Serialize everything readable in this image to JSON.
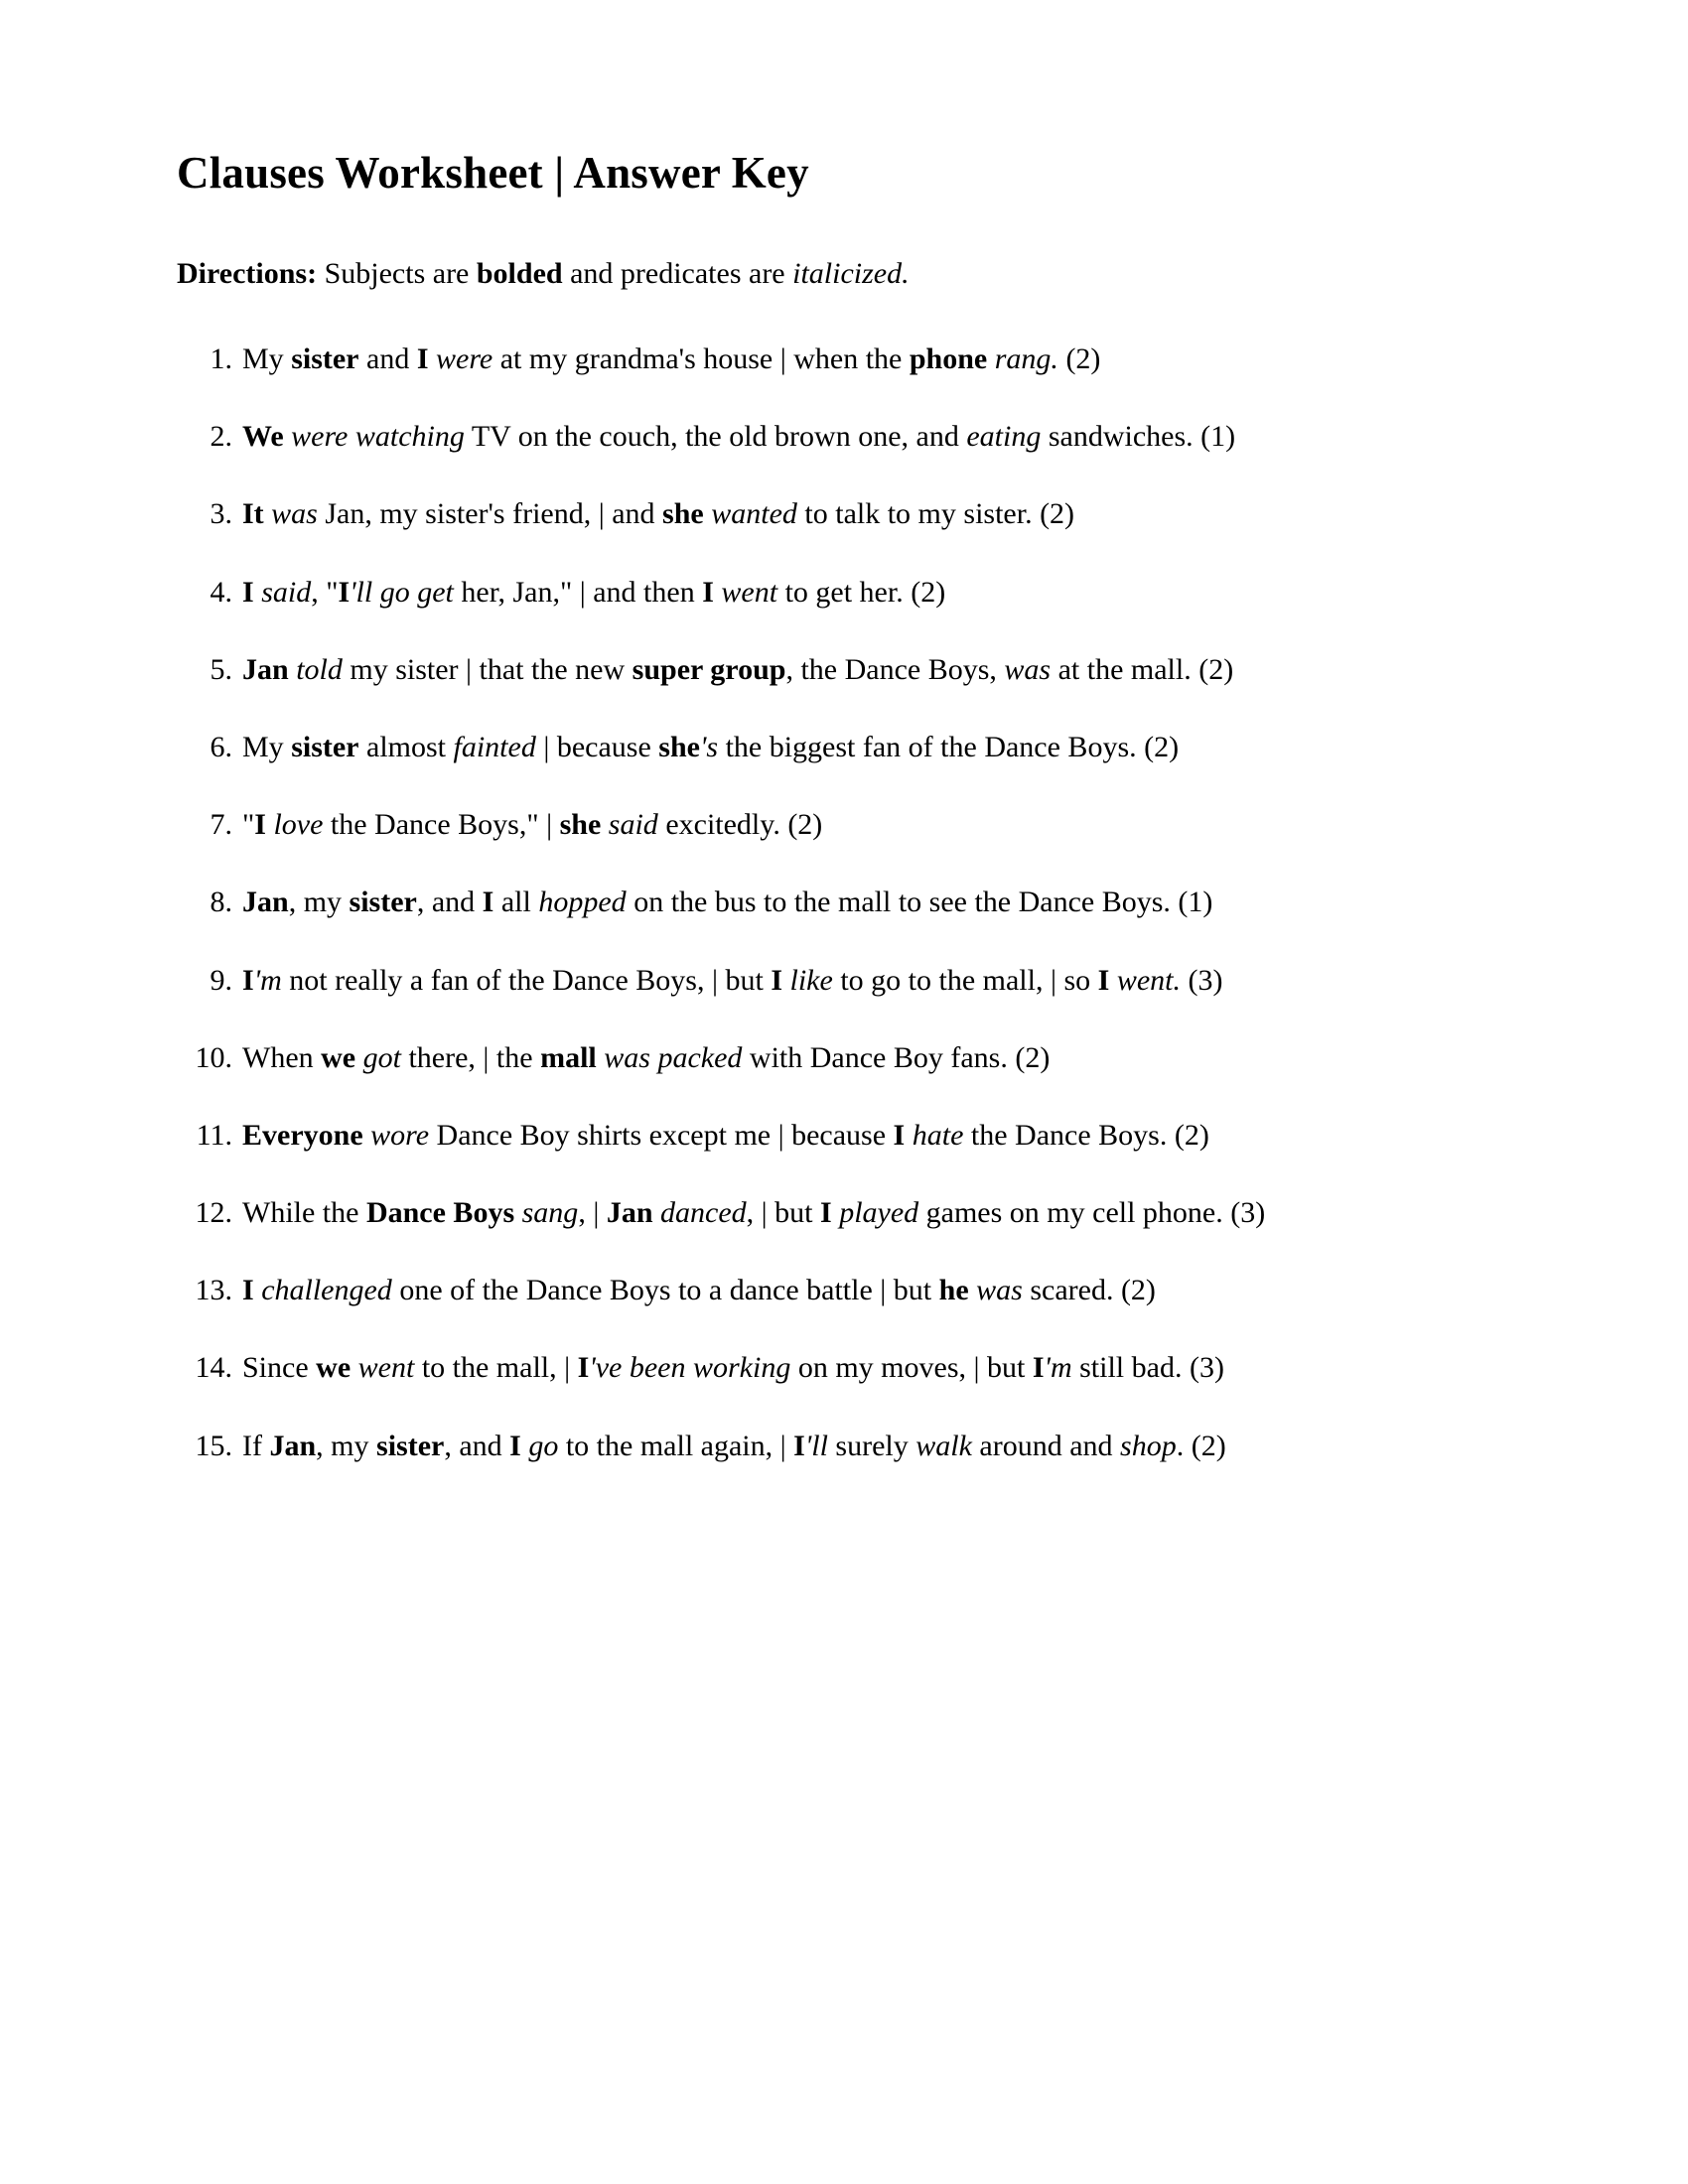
{
  "document": {
    "title": "Clauses Worksheet | Answer Key",
    "directions": [
      {
        "t": "Directions:",
        "f": "b"
      },
      {
        "t": " Subjects are ",
        "f": "n"
      },
      {
        "t": "bolded",
        "f": "b"
      },
      {
        "t": " and predicates are ",
        "f": "n"
      },
      {
        "t": "italicized.",
        "f": "i"
      }
    ],
    "items": [
      {
        "number": "1.",
        "count": "(2)",
        "segments": [
          {
            "t": "My ",
            "f": "n"
          },
          {
            "t": "sister",
            "f": "b"
          },
          {
            "t": " and ",
            "f": "n"
          },
          {
            "t": "I",
            "f": "b"
          },
          {
            "t": " were",
            "f": "i"
          },
          {
            "t": " at my grandma's house | when the ",
            "f": "n"
          },
          {
            "t": "phone",
            "f": "b"
          },
          {
            "t": " rang.",
            "f": "i"
          },
          {
            "t": " (2)",
            "f": "n"
          }
        ]
      },
      {
        "number": "2.",
        "count": "(1)",
        "segments": [
          {
            "t": "We",
            "f": "b"
          },
          {
            "t": " were watching",
            "f": "i"
          },
          {
            "t": " TV on the couch, the old brown one, and ",
            "f": "n"
          },
          {
            "t": "eating",
            "f": "i"
          },
          {
            "t": " sandwiches. (1)",
            "f": "n"
          }
        ]
      },
      {
        "number": "3.",
        "count": "(2)",
        "segments": [
          {
            "t": "It",
            "f": "b"
          },
          {
            "t": " was",
            "f": "i"
          },
          {
            "t": " Jan, my sister's friend, | and ",
            "f": "n"
          },
          {
            "t": "she",
            "f": "b"
          },
          {
            "t": " wanted",
            "f": "i"
          },
          {
            "t": " to talk to my sister. (2)",
            "f": "n"
          }
        ]
      },
      {
        "number": "4.",
        "count": "(2)",
        "segments": [
          {
            "t": "I",
            "f": "b"
          },
          {
            "t": " said",
            "f": "i"
          },
          {
            "t": ", \"",
            "f": "n"
          },
          {
            "t": "I",
            "f": "b"
          },
          {
            "t": "'ll go get",
            "f": "i"
          },
          {
            "t": " her, Jan,\" | and then ",
            "f": "n"
          },
          {
            "t": "I",
            "f": "b"
          },
          {
            "t": " went",
            "f": "i"
          },
          {
            "t": " to get her. (2)",
            "f": "n"
          }
        ]
      },
      {
        "number": "5.",
        "count": "(2)",
        "segments": [
          {
            "t": "Jan",
            "f": "b"
          },
          {
            "t": " told",
            "f": "i"
          },
          {
            "t": " my sister | that the new ",
            "f": "n"
          },
          {
            "t": "super group",
            "f": "b"
          },
          {
            "t": ", the Dance Boys, ",
            "f": "n"
          },
          {
            "t": "was",
            "f": "i"
          },
          {
            "t": " at the mall. (2)",
            "f": "n"
          }
        ]
      },
      {
        "number": "6.",
        "count": "(2)",
        "segments": [
          {
            "t": "My ",
            "f": "n"
          },
          {
            "t": "sister",
            "f": "b"
          },
          {
            "t": " almost ",
            "f": "n"
          },
          {
            "t": "fainted",
            "f": "i"
          },
          {
            "t": " | because ",
            "f": "n"
          },
          {
            "t": "she",
            "f": "b"
          },
          {
            "t": "'s",
            "f": "i"
          },
          {
            "t": " the biggest fan of the Dance Boys. (2)",
            "f": "n"
          }
        ]
      },
      {
        "number": "7.",
        "count": "(2)",
        "segments": [
          {
            "t": "\"",
            "f": "n"
          },
          {
            "t": "I",
            "f": "b"
          },
          {
            "t": " love",
            "f": "i"
          },
          {
            "t": " the Dance Boys,\" | ",
            "f": "n"
          },
          {
            "t": "she",
            "f": "b"
          },
          {
            "t": " said",
            "f": "i"
          },
          {
            "t": " excitedly. (2)",
            "f": "n"
          }
        ]
      },
      {
        "number": "8.",
        "count": "(1)",
        "segments": [
          {
            "t": "Jan",
            "f": "b"
          },
          {
            "t": ", my ",
            "f": "n"
          },
          {
            "t": "sister",
            "f": "b"
          },
          {
            "t": ", and ",
            "f": "n"
          },
          {
            "t": "I",
            "f": "b"
          },
          {
            "t": " all ",
            "f": "n"
          },
          {
            "t": "hopped",
            "f": "i"
          },
          {
            "t": " on the bus to the mall to see the Dance Boys. (1)",
            "f": "n"
          }
        ]
      },
      {
        "number": "9.",
        "count": "(3)",
        "segments": [
          {
            "t": "I",
            "f": "b"
          },
          {
            "t": "'m",
            "f": "i"
          },
          {
            "t": " not really a fan of the Dance Boys, | but ",
            "f": "n"
          },
          {
            "t": "I",
            "f": "b"
          },
          {
            "t": " like",
            "f": "i"
          },
          {
            "t": " to go to the mall, | so ",
            "f": "n"
          },
          {
            "t": "I",
            "f": "b"
          },
          {
            "t": " went.",
            "f": "i"
          },
          {
            "t": " (3)",
            "f": "n"
          }
        ]
      },
      {
        "number": "10.",
        "count": "(2)",
        "segments": [
          {
            "t": "When ",
            "f": "n"
          },
          {
            "t": "we",
            "f": "b"
          },
          {
            "t": " got",
            "f": "i"
          },
          {
            "t": " there, | the ",
            "f": "n"
          },
          {
            "t": "mall",
            "f": "b"
          },
          {
            "t": " was packed",
            "f": "i"
          },
          {
            "t": " with Dance Boy fans. (2)",
            "f": "n"
          }
        ]
      },
      {
        "number": "11.",
        "count": "(2)",
        "segments": [
          {
            "t": "Everyone",
            "f": "b"
          },
          {
            "t": " wore",
            "f": "i"
          },
          {
            "t": " Dance Boy shirts except me | because ",
            "f": "n"
          },
          {
            "t": "I",
            "f": "b"
          },
          {
            "t": " hate",
            "f": "i"
          },
          {
            "t": " the Dance Boys. (2)",
            "f": "n"
          }
        ]
      },
      {
        "number": "12.",
        "count": "(3)",
        "segments": [
          {
            "t": "While the ",
            "f": "n"
          },
          {
            "t": "Dance Boys",
            "f": "b"
          },
          {
            "t": " sang",
            "f": "i"
          },
          {
            "t": ", | ",
            "f": "n"
          },
          {
            "t": "Jan",
            "f": "b"
          },
          {
            "t": " danced",
            "f": "i"
          },
          {
            "t": ", | but ",
            "f": "n"
          },
          {
            "t": "I",
            "f": "b"
          },
          {
            "t": " played",
            "f": "i"
          },
          {
            "t": " games on my cell phone. (3)",
            "f": "n"
          }
        ]
      },
      {
        "number": "13.",
        "count": "(2)",
        "segments": [
          {
            "t": "I",
            "f": "b"
          },
          {
            "t": " challenged",
            "f": "i"
          },
          {
            "t": " one of the Dance Boys to a dance battle | but ",
            "f": "n"
          },
          {
            "t": "he",
            "f": "b"
          },
          {
            "t": " was",
            "f": "i"
          },
          {
            "t": " scared. (2)",
            "f": "n"
          }
        ]
      },
      {
        "number": "14.",
        "count": "(3)",
        "segments": [
          {
            "t": "Since ",
            "f": "n"
          },
          {
            "t": "we",
            "f": "b"
          },
          {
            "t": " went",
            "f": "i"
          },
          {
            "t": " to the mall, | ",
            "f": "n"
          },
          {
            "t": "I",
            "f": "b"
          },
          {
            "t": "'ve been working",
            "f": "i"
          },
          {
            "t": " on my moves, | but ",
            "f": "n"
          },
          {
            "t": "I",
            "f": "b"
          },
          {
            "t": "'m",
            "f": "i"
          },
          {
            "t": " still bad. (3)",
            "f": "n"
          }
        ]
      },
      {
        "number": "15.",
        "count": "(2)",
        "segments": [
          {
            "t": "If ",
            "f": "n"
          },
          {
            "t": "Jan",
            "f": "b"
          },
          {
            "t": ", my ",
            "f": "n"
          },
          {
            "t": "sister",
            "f": "b"
          },
          {
            "t": ", and ",
            "f": "n"
          },
          {
            "t": "I",
            "f": "b"
          },
          {
            "t": " go",
            "f": "i"
          },
          {
            "t": " to the mall again, | ",
            "f": "n"
          },
          {
            "t": "I",
            "f": "b"
          },
          {
            "t": "'ll",
            "f": "i"
          },
          {
            "t": " surely ",
            "f": "n"
          },
          {
            "t": "walk",
            "f": "i"
          },
          {
            "t": " around and ",
            "f": "n"
          },
          {
            "t": "shop",
            "f": "i"
          },
          {
            "t": ". (2)",
            "f": "n"
          }
        ]
      }
    ]
  }
}
